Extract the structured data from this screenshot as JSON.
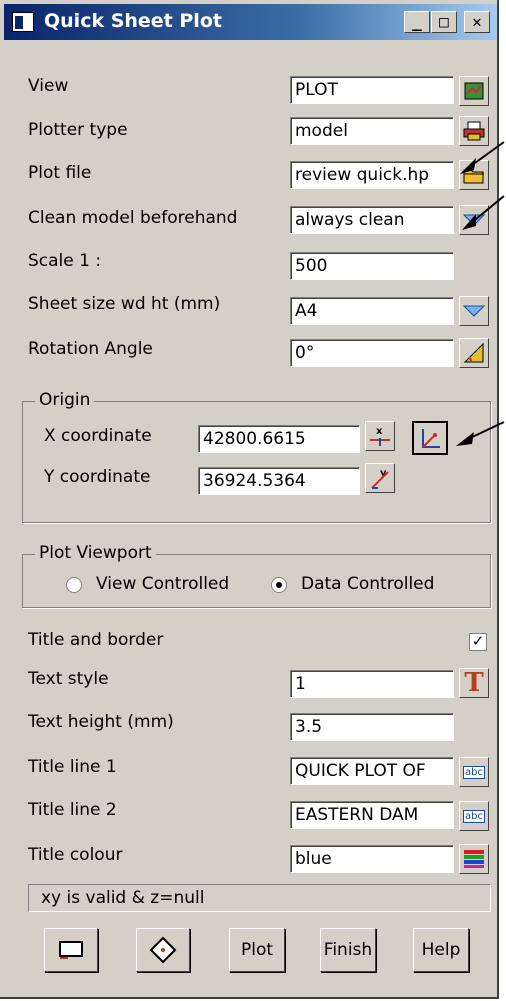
{
  "window": {
    "title": "Quick Sheet Plot",
    "min_icon": "minimize-icon",
    "max_icon": "maximize-icon",
    "close_icon": "close-icon"
  },
  "rows": {
    "view": {
      "label": "View",
      "value": "PLOT"
    },
    "plotter_type": {
      "label": "Plotter type",
      "value": "model"
    },
    "plot_file": {
      "label": "Plot file",
      "value": "review quick.hp"
    },
    "clean_model": {
      "label": "Clean model beforehand",
      "value": "always clean"
    },
    "scale": {
      "label": "Scale 1 :",
      "value": "500"
    },
    "sheet_size": {
      "label": "Sheet size wd ht (mm)",
      "value": "A4"
    },
    "rotation": {
      "label": "Rotation Angle",
      "value": "0°"
    }
  },
  "origin": {
    "title": "Origin",
    "x_label": "X coordinate",
    "x_value": "42800.6615",
    "y_label": "Y coordinate",
    "y_value": "36924.5364"
  },
  "viewport": {
    "title": "Plot Viewport",
    "option1": "View Controlled",
    "option2": "Data Controlled",
    "selected": "Data Controlled"
  },
  "title_border": {
    "label": "Title and border",
    "checked": true
  },
  "text": {
    "style_label": "Text style",
    "style_value": "1",
    "height_label": "Text height (mm)",
    "height_value": "3.5",
    "line1_label": "Title line 1",
    "line1_value": "QUICK PLOT OF",
    "line2_label": "Title line 2",
    "line2_value": "EASTERN DAM",
    "colour_label": "Title colour",
    "colour_value": "blue"
  },
  "status": "xy is valid & z=null",
  "buttons": {
    "plot": "Plot",
    "finish": "Finish",
    "help": "Help"
  },
  "colors": {
    "titlebar_start": "#0a246a",
    "titlebar_end": "#a6caf0",
    "dialog_bg": "#d4d0c8"
  }
}
